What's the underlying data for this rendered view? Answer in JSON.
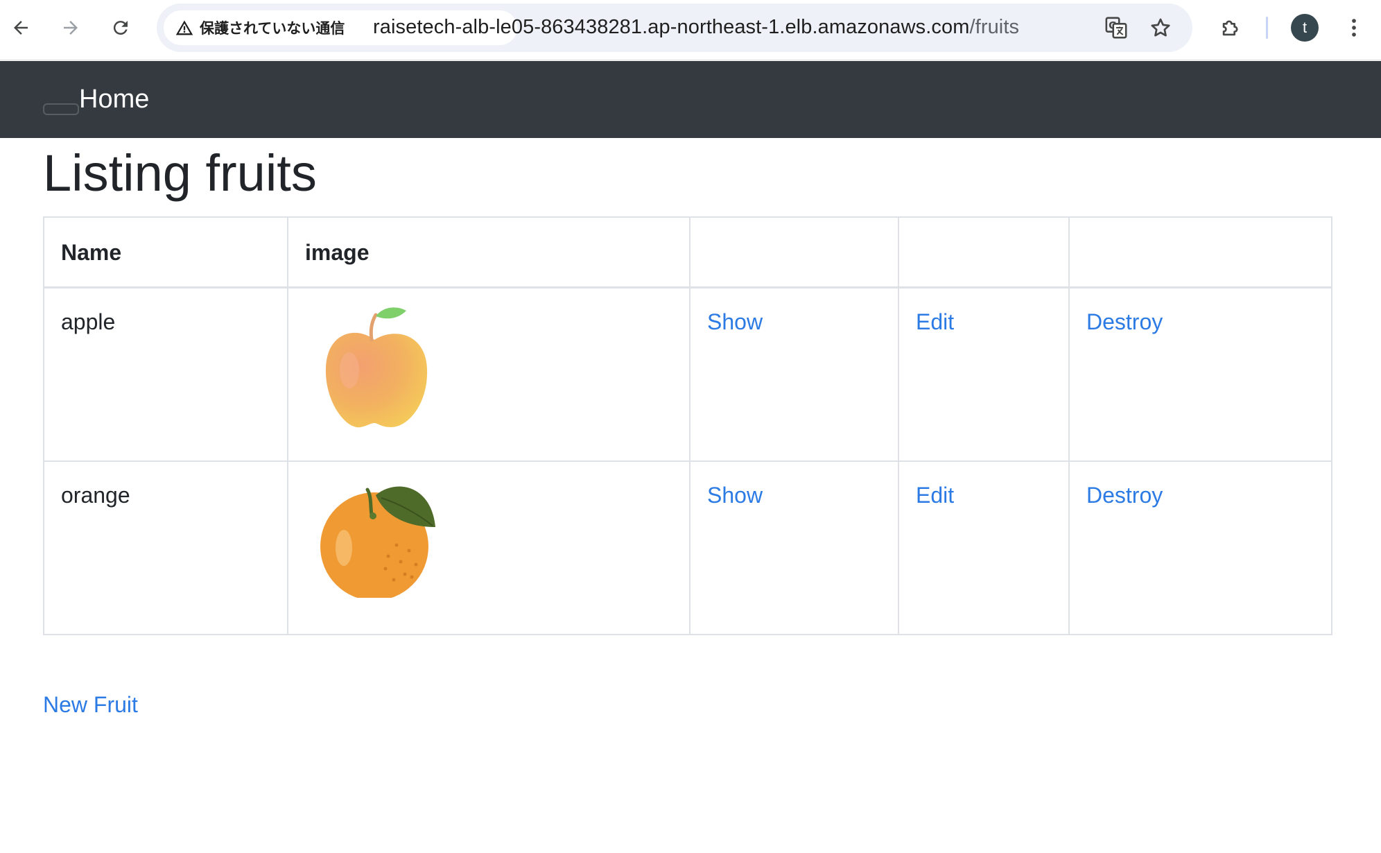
{
  "browser": {
    "security_label": "保護されていない通信",
    "url_host": "raisetech-alb-le05-863438281.ap-northeast-1.elb.amazonaws.com",
    "url_path": "/fruits",
    "profile_initial": "t",
    "icons": [
      "back-arrow-icon",
      "forward-arrow-icon",
      "reload-icon",
      "warning-icon",
      "translate-icon",
      "star-icon",
      "extensions-icon",
      "more-vert-icon"
    ]
  },
  "navbar": {
    "brand": "Home"
  },
  "main": {
    "title": "Listing fruits",
    "table": {
      "headers": [
        "Name",
        "image",
        "",
        "",
        ""
      ],
      "rows": [
        {
          "name": "apple",
          "image": "apple-image",
          "show": "Show",
          "edit": "Edit",
          "destroy": "Destroy"
        },
        {
          "name": "orange",
          "image": "orange-image",
          "show": "Show",
          "edit": "Edit",
          "destroy": "Destroy"
        }
      ]
    },
    "new_link": "New Fruit"
  },
  "colors": {
    "navbar_bg": "#343a40",
    "link": "#2c7be5",
    "border": "#dee2e6",
    "text": "#212529",
    "omnibox_bg": "#eef1f8"
  }
}
